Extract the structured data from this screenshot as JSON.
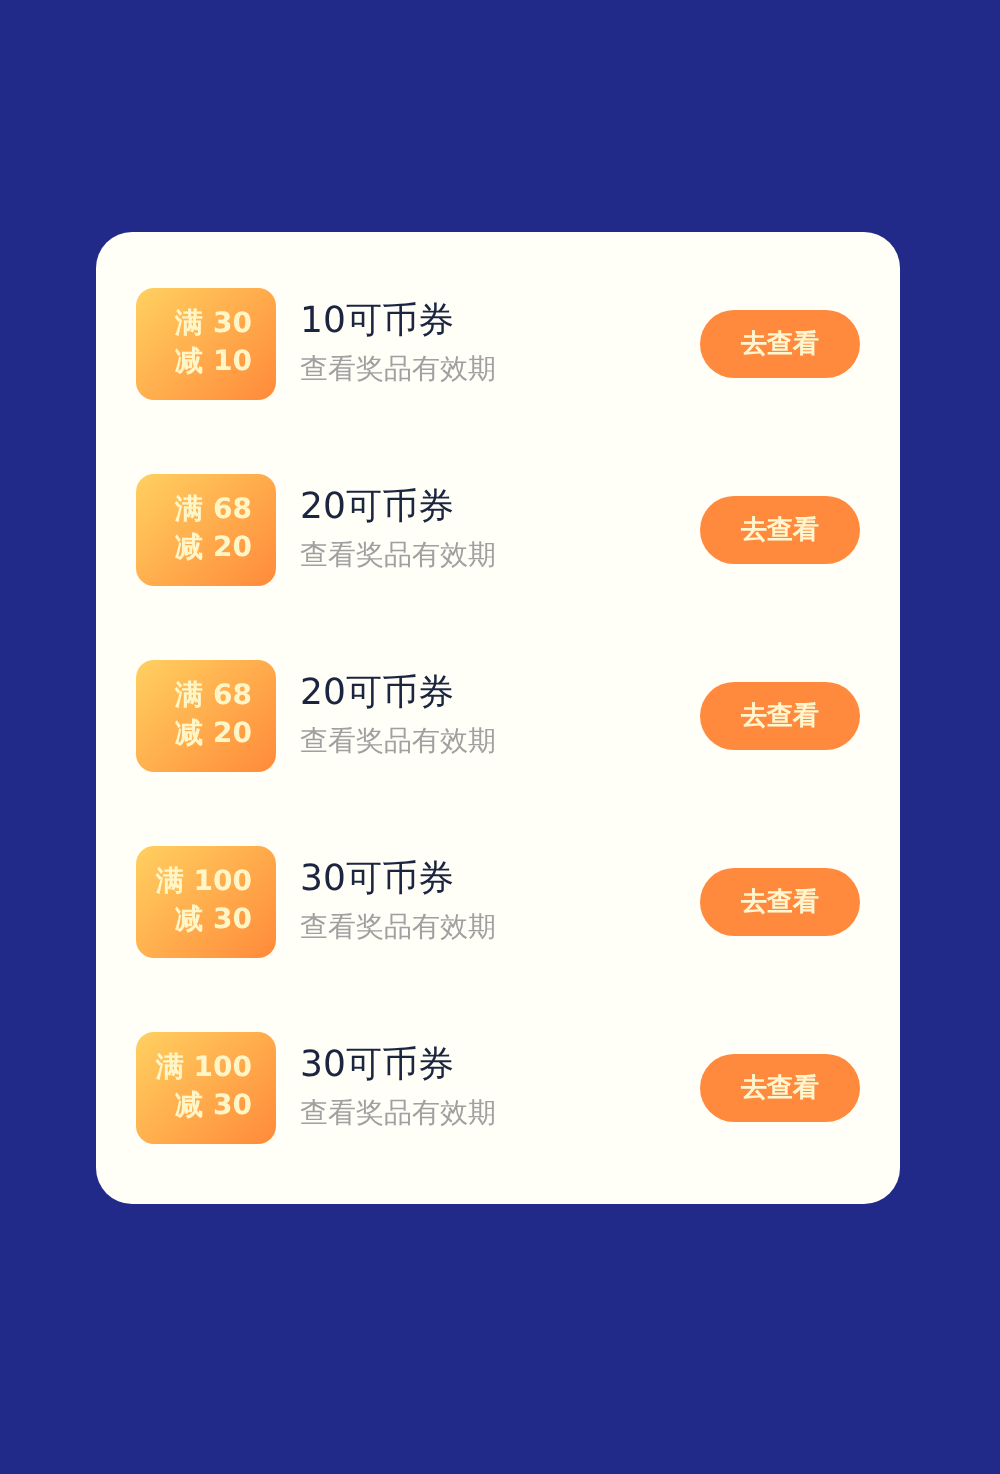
{
  "coupons": [
    {
      "badge_lines": [
        "满 30",
        "减 10"
      ],
      "title": "10可币券",
      "subtitle": "查看奖品有效期",
      "button": "去查看"
    },
    {
      "badge_lines": [
        "满 68",
        "减 20"
      ],
      "title": "20可币券",
      "subtitle": "查看奖品有效期",
      "button": "去查看"
    },
    {
      "badge_lines": [
        "满 68",
        "减 20"
      ],
      "title": "20可币券",
      "subtitle": "查看奖品有效期",
      "button": "去查看"
    },
    {
      "badge_lines": [
        "满 100",
        "减 30"
      ],
      "title": "30可币券",
      "subtitle": "查看奖品有效期",
      "button": "去查看"
    },
    {
      "badge_lines": [
        "满 100",
        "减 30"
      ],
      "title": "30可币券",
      "subtitle": "查看奖品有效期",
      "button": "去查看"
    }
  ]
}
